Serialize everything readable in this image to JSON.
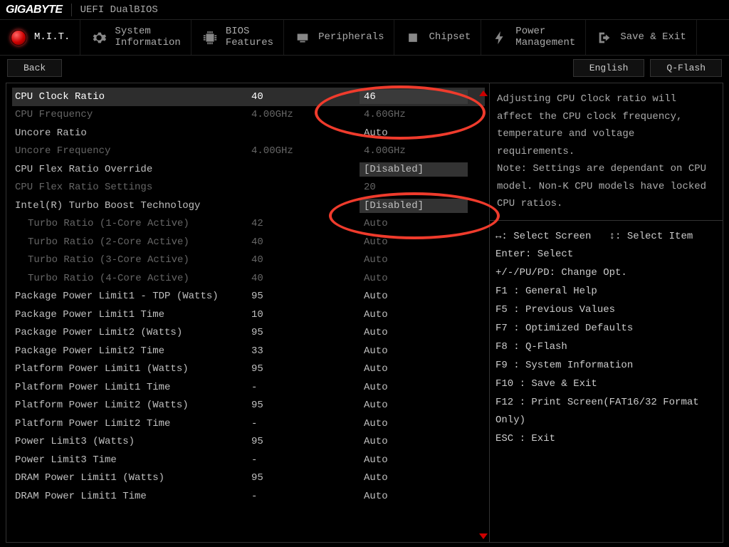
{
  "header": {
    "brand": "GIGABYTE",
    "subtitle": "UEFI DualBIOS"
  },
  "tabs": [
    {
      "label": "M.I.T."
    },
    {
      "label": "System\nInformation"
    },
    {
      "label": "BIOS\nFeatures"
    },
    {
      "label": "Peripherals"
    },
    {
      "label": "Chipset"
    },
    {
      "label": "Power\nManagement"
    },
    {
      "label": "Save & Exit"
    }
  ],
  "buttons": {
    "back": "Back",
    "language": "English",
    "qflash": "Q-Flash"
  },
  "rows": [
    {
      "name": "CPU Clock Ratio",
      "def": "40",
      "val": "46"
    },
    {
      "name": "CPU Frequency",
      "def": "4.00GHz",
      "val": "4.60GHz"
    },
    {
      "name": "Uncore Ratio",
      "def": "",
      "val": "Auto"
    },
    {
      "name": "Uncore Frequency",
      "def": "4.00GHz",
      "val": "4.00GHz"
    },
    {
      "name": "CPU Flex Ratio Override",
      "def": "",
      "val": "[Disabled]"
    },
    {
      "name": "CPU Flex Ratio Settings",
      "def": "",
      "val": "20"
    },
    {
      "name": "Intel(R) Turbo Boost Technology",
      "def": "",
      "val": "[Disabled]"
    },
    {
      "name": "Turbo Ratio (1-Core Active)",
      "def": "42",
      "val": "Auto"
    },
    {
      "name": "Turbo Ratio (2-Core Active)",
      "def": "40",
      "val": "Auto"
    },
    {
      "name": "Turbo Ratio (3-Core Active)",
      "def": "40",
      "val": "Auto"
    },
    {
      "name": "Turbo Ratio (4-Core Active)",
      "def": "40",
      "val": "Auto"
    },
    {
      "name": "Package Power Limit1 - TDP (Watts)",
      "def": "95",
      "val": "Auto"
    },
    {
      "name": "Package Power Limit1 Time",
      "def": "10",
      "val": "Auto"
    },
    {
      "name": "Package Power Limit2 (Watts)",
      "def": "95",
      "val": "Auto"
    },
    {
      "name": "Package Power Limit2 Time",
      "def": "33",
      "val": "Auto"
    },
    {
      "name": "Platform Power Limit1 (Watts)",
      "def": "95",
      "val": "Auto"
    },
    {
      "name": "Platform Power Limit1 Time",
      "def": "-",
      "val": "Auto"
    },
    {
      "name": "Platform Power Limit2 (Watts)",
      "def": "95",
      "val": "Auto"
    },
    {
      "name": "Platform Power Limit2 Time",
      "def": "-",
      "val": "Auto"
    },
    {
      "name": "Power Limit3 (Watts)",
      "def": "95",
      "val": "Auto"
    },
    {
      "name": "Power Limit3 Time",
      "def": "-",
      "val": "Auto"
    },
    {
      "name": "DRAM Power Limit1 (Watts)",
      "def": "95",
      "val": "Auto"
    },
    {
      "name": "DRAM Power Limit1 Time",
      "def": "-",
      "val": "Auto"
    }
  ],
  "help": "Adjusting CPU Clock ratio will affect the CPU clock frequency, temperature and voltage requirements.\nNote: Settings are dependant  on  CPU model. Non-K CPU models have locked CPU ratios.",
  "keys": {
    "topline": "↔: Select Screen   ↕: Select Item",
    "lines": [
      "Enter: Select",
      "+/-/PU/PD: Change Opt.",
      "F1  : General Help",
      "F5  : Previous Values",
      "F7  : Optimized Defaults",
      "F8  : Q-Flash",
      "F9  : System Information",
      "F10 : Save & Exit",
      "F12 : Print Screen(FAT16/32 Format Only)",
      "ESC : Exit"
    ]
  }
}
